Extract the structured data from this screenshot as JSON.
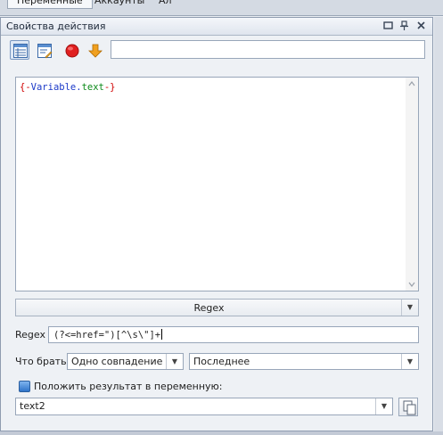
{
  "tabs": [
    "Переменные",
    "Аккаунты",
    "Ал"
  ],
  "panel": {
    "title": "Свойства действия",
    "editor_tokens": [
      "{-",
      "Variable",
      ".",
      "text",
      "-}"
    ],
    "regex_combo_value": "Regex",
    "regex_label": "Regex",
    "regex_value": "(?<=href=\")[^\\s\\\"]+",
    "what_label": "Что брать",
    "what_value": "Одно совпадение",
    "which_value": "Последнее",
    "save_label": "Положить результат в переменную:",
    "variable_value": "text2"
  },
  "colors": {
    "brace": "#d00000",
    "object": "#1a38c8",
    "property": "#0c8a1a",
    "record_red": "#e02020",
    "arrow_orange": "#f0a020"
  }
}
